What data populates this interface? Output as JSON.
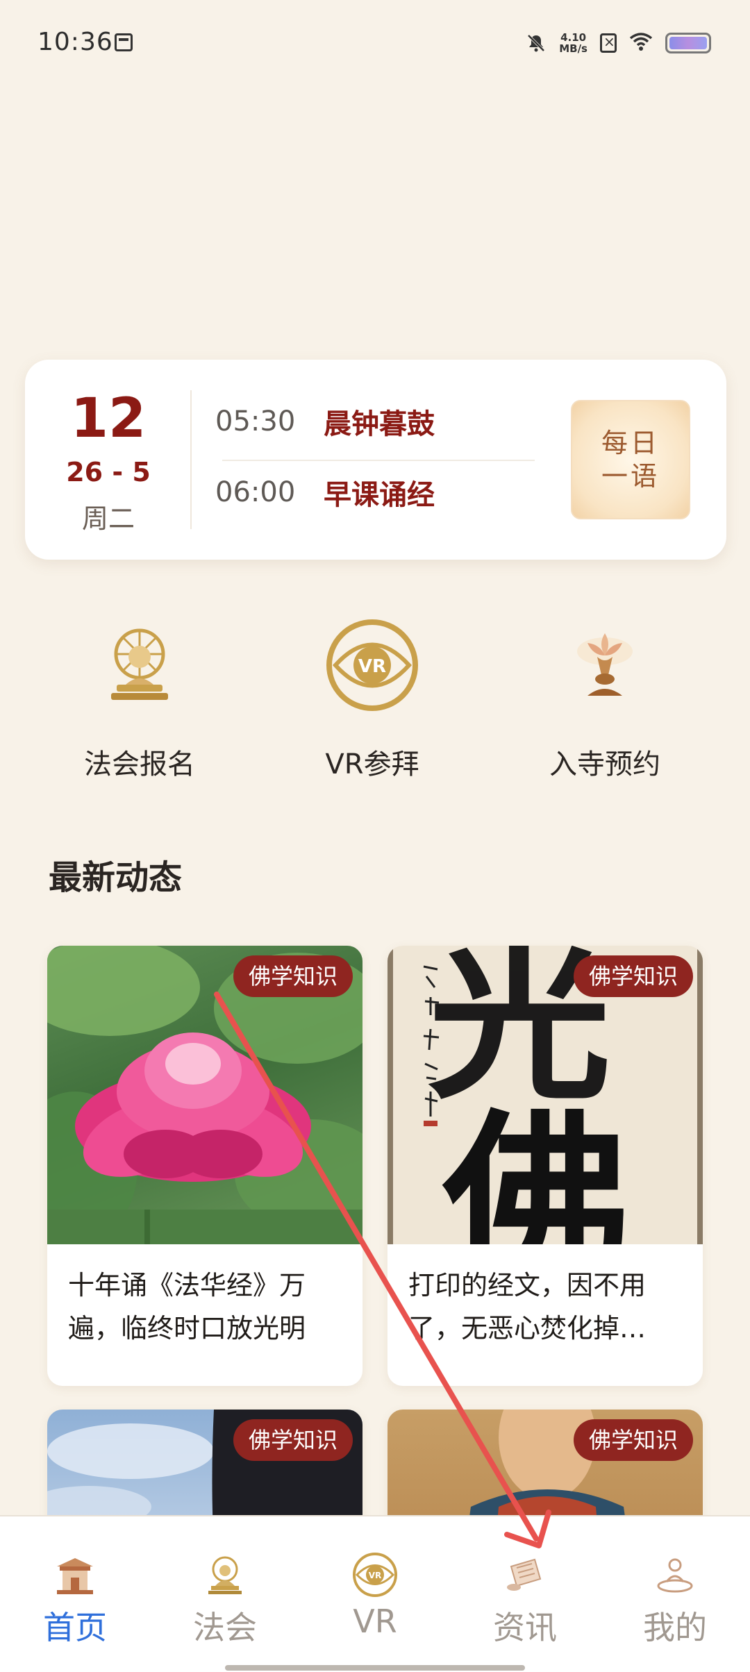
{
  "status_bar": {
    "time": "10:36",
    "net_speed_value": "4.10",
    "net_speed_unit": "MB/s"
  },
  "date_card": {
    "day": "12",
    "year_month": "26 - 5",
    "weekday": "周二",
    "schedule": [
      {
        "time": "05:30",
        "event": "晨钟暮鼓"
      },
      {
        "time": "06:00",
        "event": "早课诵经"
      }
    ],
    "daily_quote_label": "每日一语"
  },
  "quick_entries": [
    {
      "label": "法会报名",
      "icon": "dharma-wheel-icon"
    },
    {
      "label": "VR参拜",
      "icon": "vr-eye-icon"
    },
    {
      "label": "入寺预约",
      "icon": "lotus-lamp-icon"
    }
  ],
  "feed": {
    "section_title": "最新动态",
    "cards": [
      {
        "tag": "佛学知识",
        "caption": "十年诵《法华经》万遍，临终时口放光明"
      },
      {
        "tag": "佛学知识",
        "caption": "打印的经文，因不用了，无恶心焚化掉…"
      },
      {
        "tag": "佛学知识",
        "caption": ""
      },
      {
        "tag": "佛学知识",
        "caption": ""
      }
    ],
    "calligraphy_text": "佛",
    "vr_badge": "VR"
  },
  "bottom_nav": {
    "items": [
      {
        "label": "首页",
        "icon": "temple-icon",
        "active": true
      },
      {
        "label": "法会",
        "icon": "buddha-icon",
        "active": false
      },
      {
        "label": "VR",
        "icon": "vr-icon",
        "active": false
      },
      {
        "label": "资讯",
        "icon": "scroll-icon",
        "active": false
      },
      {
        "label": "我的",
        "icon": "meditating-person-icon",
        "active": false
      }
    ]
  },
  "colors": {
    "background": "#F8F2E8",
    "accent_red": "#8B1A14",
    "tag_bg": "#8F2520",
    "nav_active": "#2F6FDB",
    "gold": "#C9A04A"
  }
}
